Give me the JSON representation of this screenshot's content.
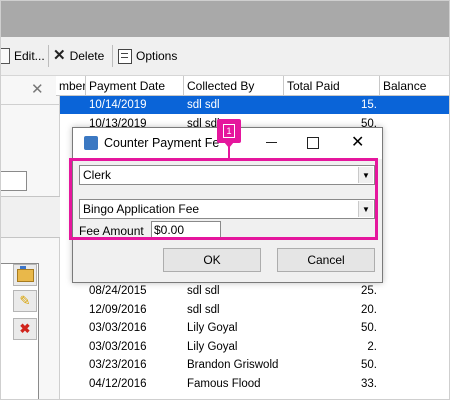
{
  "toolbar": {
    "edit_label": "Edit...",
    "delete_label": "Delete",
    "options_label": "Options"
  },
  "grid": {
    "columns": [
      "mber",
      "Payment Date",
      "Collected By",
      "Total Paid",
      "Balance"
    ],
    "rows": [
      {
        "date": "10/14/2019",
        "by": "sdl sdl",
        "paid": "15.",
        "selected": true
      },
      {
        "date": "10/13/2019",
        "by": "sdl sdl",
        "paid": "50."
      },
      {
        "date": "",
        "by": "",
        "paid": ""
      },
      {
        "date": "",
        "by": "",
        "paid": ""
      },
      {
        "date": "",
        "by": "",
        "paid": ""
      },
      {
        "date": "",
        "by": "",
        "paid": ""
      },
      {
        "date": "",
        "by": "",
        "paid": ""
      },
      {
        "date": "",
        "by": "",
        "paid": ""
      },
      {
        "date": "",
        "by": "",
        "paid": ""
      },
      {
        "date": "",
        "by": "",
        "paid": ""
      },
      {
        "date": "08/24/2015",
        "by": "sdl sdl",
        "paid": "25."
      },
      {
        "date": "12/09/2016",
        "by": "sdl sdl",
        "paid": "20."
      },
      {
        "date": "03/03/2016",
        "by": "Lily Goyal",
        "paid": "50."
      },
      {
        "date": "03/03/2016",
        "by": "Lily Goyal",
        "paid": "2."
      },
      {
        "date": "03/23/2016",
        "by": "Brandon Griswold",
        "paid": "50."
      },
      {
        "date": "04/12/2016",
        "by": "Famous Flood",
        "paid": "33."
      },
      {
        "date": "",
        "by": "",
        "paid": ""
      }
    ]
  },
  "dialog": {
    "title": "Counter Payment Fe",
    "type_select": "Clerk",
    "fee_select": "Bingo Application Fee",
    "fee_amount_label": "Fee Amount",
    "fee_amount_value": "$0.00",
    "ok_label": "OK",
    "cancel_label": "Cancel",
    "badge": "1"
  },
  "colors": {
    "highlight": "#e5169d",
    "selection": "#0a64d8"
  }
}
